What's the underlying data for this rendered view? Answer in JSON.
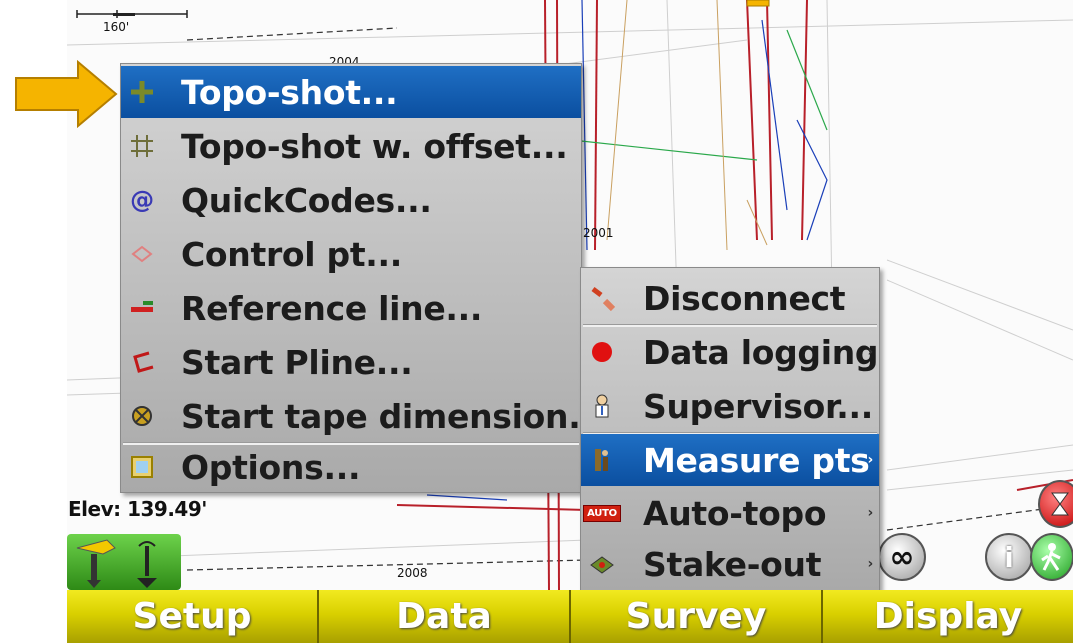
{
  "map": {
    "scale_label": "160'",
    "elev_label": "Elev: 139.49'",
    "labels": [
      "2004",
      "2001",
      "2008"
    ]
  },
  "topo_menu": {
    "items": [
      {
        "label": "Topo-shot...",
        "icon": "topo-shot-icon",
        "selected": true
      },
      {
        "label": "Topo-shot w. offset...",
        "icon": "topo-offset-icon",
        "selected": false
      },
      {
        "label": "QuickCodes...",
        "icon": "quickcodes-icon",
        "selected": false
      },
      {
        "label": "Control pt...",
        "icon": "control-point-icon",
        "selected": false
      },
      {
        "label": "Reference line...",
        "icon": "reference-line-icon",
        "selected": false
      },
      {
        "label": "Start Pline...",
        "icon": "pline-icon",
        "selected": false
      },
      {
        "label": "Start tape dimension...",
        "icon": "tape-dimension-icon",
        "selected": false
      },
      {
        "label": "Options...",
        "icon": "options-icon",
        "selected": false
      }
    ]
  },
  "survey_menu": {
    "items": [
      {
        "label": "Disconnect",
        "icon": "disconnect-icon",
        "submenu": false,
        "selected": false
      },
      {
        "label": "Data logging",
        "icon": "data-logging-icon",
        "submenu": true,
        "selected": false
      },
      {
        "label": "Supervisor...",
        "icon": "supervisor-icon",
        "submenu": false,
        "selected": false
      },
      {
        "label": "Measure pts",
        "icon": "measure-pts-icon",
        "submenu": true,
        "selected": true
      },
      {
        "label": "Auto-topo",
        "icon": "auto-topo-icon",
        "submenu": true,
        "selected": false
      },
      {
        "label": "Stake-out",
        "icon": "stake-out-icon",
        "submenu": true,
        "selected": false
      }
    ],
    "submenu_arrow": "›",
    "auto_badge": "AUTO"
  },
  "bottom_bar": {
    "buttons": [
      "Setup",
      "Data",
      "Survey",
      "Display"
    ]
  },
  "colors": {
    "accent_blue": "#0b4fa0",
    "bar_yellow": "#d9d000",
    "pointer_orange": "#f5b400"
  },
  "status": {
    "infinity_symbol": "∞",
    "info_symbol": "i"
  }
}
